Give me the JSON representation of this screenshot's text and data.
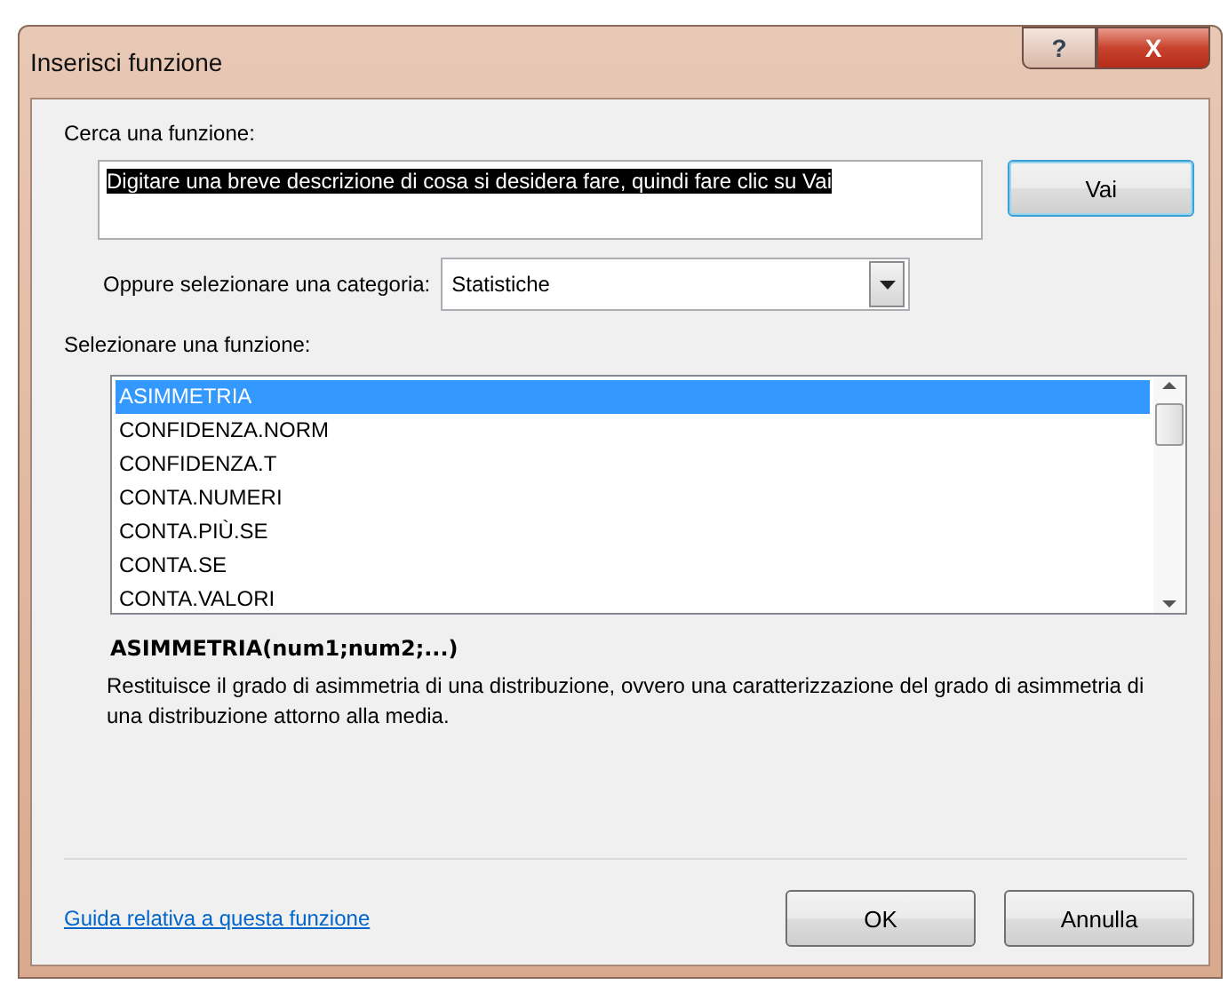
{
  "window": {
    "title": "Inserisci funzione",
    "buttons": [
      {
        "kind": "help",
        "label": "?"
      },
      {
        "kind": "close",
        "label": "X"
      }
    ]
  },
  "search": {
    "label": "Cerca una funzione:",
    "value": "Digitare una breve descrizione di cosa si desidera fare, quindi fare clic su Vai",
    "value_selected": true,
    "button": "Vai"
  },
  "category": {
    "label": "Oppure selezionare una categoria:",
    "value": "Statistiche"
  },
  "functions": {
    "label": "Selezionare una funzione:",
    "items": [
      {
        "label": "ASIMMETRIA",
        "selected": true
      },
      {
        "label": "CONFIDENZA.NORM",
        "selected": false
      },
      {
        "label": "CONFIDENZA.T",
        "selected": false
      },
      {
        "label": "CONTA.NUMERI",
        "selected": false
      },
      {
        "label": "CONTA.PIÙ.SE",
        "selected": false
      },
      {
        "label": "CONTA.SE",
        "selected": false
      },
      {
        "label": "CONTA.VALORI",
        "selected": false
      }
    ]
  },
  "signature": "ASIMMETRIA(num1;num2;...)",
  "description": "Restituisce il grado di asimmetria di una distribuzione, ovvero una caratterizzazione del grado di asimmetria di una distribuzione attorno alla media.",
  "help_link": "Guida relativa a questa funzione",
  "buttons": [
    "OK",
    "Annulla"
  ]
}
